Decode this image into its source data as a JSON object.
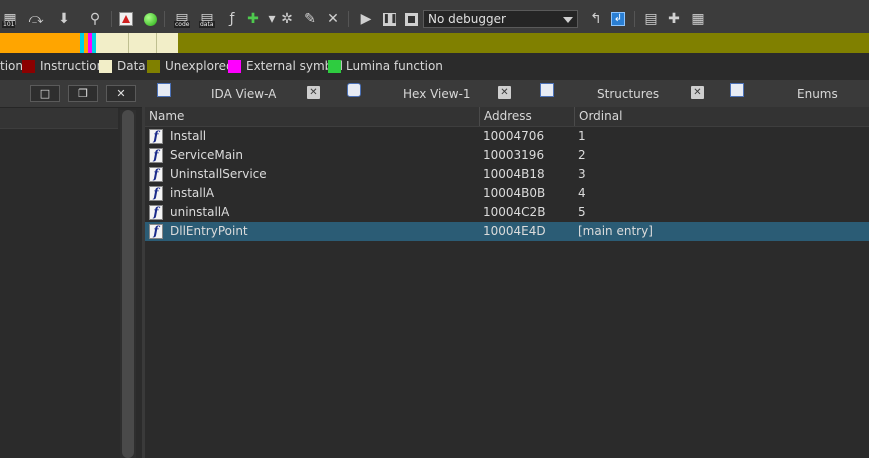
{
  "toolbar": {
    "debugger_select": {
      "value": "No debugger"
    },
    "icons": [
      "hex-view-icon",
      "jump-icon",
      "step-into-icon",
      "breakpoint-search-icon",
      "warning-icon",
      "green-dot-icon",
      "code-icon",
      "data-icon",
      "add-function-icon",
      "star-icon",
      "edit-icon",
      "delete-icon",
      "play-icon",
      "pause-icon",
      "stop-icon",
      "attach-process-icon",
      "run-to-cursor-icon",
      "window-list-icon",
      "add-enum-icon",
      "grid-icon"
    ],
    "colors": {
      "bg": "#3c3c3c",
      "accent": "#2a7fd4"
    }
  },
  "navband": {
    "colors": {
      "library": "#ffa500",
      "cyan": "#00d2e6",
      "magenta": "#ff00ff",
      "data": "#f2eec8",
      "unexplored": "#808000"
    }
  },
  "legend": {
    "items": [
      {
        "label": "tion",
        "color": ""
      },
      {
        "label": "Instruction",
        "color": "#8b0000"
      },
      {
        "label": "Data",
        "color": "#f2eec8"
      },
      {
        "label": "Unexplored",
        "color": "#808000"
      },
      {
        "label": "External symbol",
        "color": "#ff00ff"
      },
      {
        "label": "Lumina function",
        "color": "#2ecc40"
      }
    ]
  },
  "left_pane": {
    "buttons": [
      {
        "name": "restore-icon",
        "glyph": "□"
      },
      {
        "name": "float-icon",
        "glyph": "❐"
      },
      {
        "name": "close-icon",
        "glyph": "✕"
      }
    ]
  },
  "tabs": [
    {
      "label": "IDA View-A",
      "icon": "ida-view-icon",
      "close": "✕"
    },
    {
      "label": "Hex View-1",
      "icon": "hex-view-tab-icon",
      "close": "✕"
    },
    {
      "label": "Structures",
      "icon": "structures-icon",
      "close": "✕"
    },
    {
      "label": "Enums",
      "icon": "enums-icon",
      "close": ""
    }
  ],
  "table": {
    "columns": [
      "Name",
      "Address",
      "Ordinal"
    ],
    "rows": [
      {
        "name": "Install",
        "address": "10004706",
        "ordinal": "1",
        "icon": "f"
      },
      {
        "name": "ServiceMain",
        "address": "10003196",
        "ordinal": "2",
        "icon": "f"
      },
      {
        "name": "UninstallService",
        "address": "10004B18",
        "ordinal": "3",
        "icon": "f"
      },
      {
        "name": "installA",
        "address": "10004B0B",
        "ordinal": "4",
        "icon": "f"
      },
      {
        "name": "uninstallA",
        "address": "10004C2B",
        "ordinal": "5",
        "icon": "f"
      },
      {
        "name": "DllEntryPoint",
        "address": "10004E4D",
        "ordinal": "[main entry]",
        "icon": "f",
        "selected": true
      }
    ],
    "colors": {
      "selected_row": "#2b5c75"
    }
  }
}
